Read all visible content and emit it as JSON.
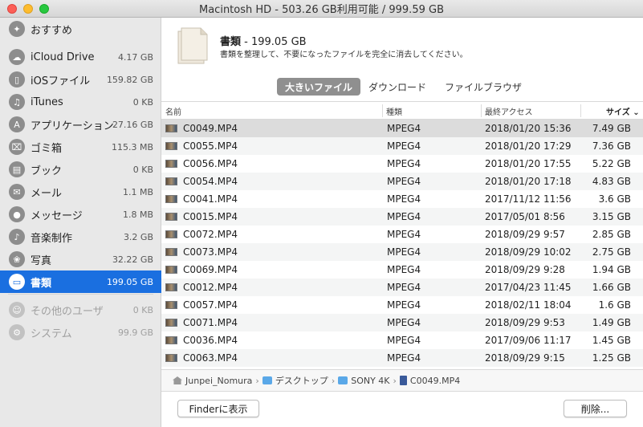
{
  "window": {
    "title": "Macintosh HD - 503.26 GB利用可能 / 999.59 GB"
  },
  "sidebar": {
    "items": [
      {
        "label": "おすすめ",
        "size": "",
        "icon": "bulb-icon",
        "glyph": "✦"
      },
      {
        "label": "iCloud Drive",
        "size": "4.17 GB",
        "icon": "cloud-icon",
        "glyph": "☁"
      },
      {
        "label": "iOSファイル",
        "size": "159.82 GB",
        "icon": "phone-icon",
        "glyph": "▯"
      },
      {
        "label": "iTunes",
        "size": "0 KB",
        "icon": "music-note-icon",
        "glyph": "♫"
      },
      {
        "label": "アプリケーション",
        "size": "27.16 GB",
        "icon": "app-store-icon",
        "glyph": "A"
      },
      {
        "label": "ゴミ箱",
        "size": "115.3 MB",
        "icon": "trash-icon",
        "glyph": "⌧"
      },
      {
        "label": "ブック",
        "size": "0 KB",
        "icon": "book-icon",
        "glyph": "▤"
      },
      {
        "label": "メール",
        "size": "1.1 MB",
        "icon": "mail-icon",
        "glyph": "✉"
      },
      {
        "label": "メッセージ",
        "size": "1.8 MB",
        "icon": "message-bubble-icon",
        "glyph": "●"
      },
      {
        "label": "音楽制作",
        "size": "3.2 GB",
        "icon": "guitar-icon",
        "glyph": "♪"
      },
      {
        "label": "写真",
        "size": "32.22 GB",
        "icon": "photos-icon",
        "glyph": "❀"
      },
      {
        "label": "書類",
        "size": "199.05 GB",
        "icon": "document-icon",
        "glyph": "▭"
      },
      {
        "label": "その他のユーザ",
        "size": "0 KB",
        "icon": "users-icon",
        "glyph": "☺"
      },
      {
        "label": "システム",
        "size": "99.9 GB",
        "icon": "system-gear-icon",
        "glyph": "⚙"
      }
    ],
    "selected_index": 11
  },
  "header": {
    "title": "書類",
    "size": " - 199.05 GB",
    "description": "書類を整理して、不要になったファイルを完全に消去してください。"
  },
  "tabs": [
    {
      "label": "大きいファイル",
      "active": true
    },
    {
      "label": "ダウンロード",
      "active": false
    },
    {
      "label": "ファイルブラウザ",
      "active": false
    }
  ],
  "table": {
    "columns": {
      "name": "名前",
      "kind": "種類",
      "last_access": "最終アクセス",
      "size": "サイズ"
    },
    "rows": [
      {
        "name": "C0049.MP4",
        "kind": "MPEG4",
        "date": "2018/01/20 15:36",
        "size": "7.49 GB"
      },
      {
        "name": "C0055.MP4",
        "kind": "MPEG4",
        "date": "2018/01/20 17:29",
        "size": "7.36 GB"
      },
      {
        "name": "C0056.MP4",
        "kind": "MPEG4",
        "date": "2018/01/20 17:55",
        "size": "5.22 GB"
      },
      {
        "name": "C0054.MP4",
        "kind": "MPEG4",
        "date": "2018/01/20 17:18",
        "size": "4.83 GB"
      },
      {
        "name": "C0041.MP4",
        "kind": "MPEG4",
        "date": "2017/11/12 11:56",
        "size": "3.6 GB"
      },
      {
        "name": "C0015.MP4",
        "kind": "MPEG4",
        "date": "2017/05/01 8:56",
        "size": "3.15 GB"
      },
      {
        "name": "C0072.MP4",
        "kind": "MPEG4",
        "date": "2018/09/29 9:57",
        "size": "2.85 GB"
      },
      {
        "name": "C0073.MP4",
        "kind": "MPEG4",
        "date": "2018/09/29 10:02",
        "size": "2.75 GB"
      },
      {
        "name": "C0069.MP4",
        "kind": "MPEG4",
        "date": "2018/09/29 9:28",
        "size": "1.94 GB"
      },
      {
        "name": "C0012.MP4",
        "kind": "MPEG4",
        "date": "2017/04/23 11:45",
        "size": "1.66 GB"
      },
      {
        "name": "C0057.MP4",
        "kind": "MPEG4",
        "date": "2018/02/11 18:04",
        "size": "1.6 GB"
      },
      {
        "name": "C0071.MP4",
        "kind": "MPEG4",
        "date": "2018/09/29 9:53",
        "size": "1.49 GB"
      },
      {
        "name": "C0036.MP4",
        "kind": "MPEG4",
        "date": "2017/09/06 11:17",
        "size": "1.45 GB"
      },
      {
        "name": "C0063.MP4",
        "kind": "MPEG4",
        "date": "2018/09/29 9:15",
        "size": "1.25 GB"
      }
    ],
    "selected_index": 0
  },
  "path": {
    "crumbs": [
      {
        "label": "Junpei_Nomura",
        "icon": "home-icon"
      },
      {
        "label": "デスクトップ",
        "icon": "folder-icon"
      },
      {
        "label": "SONY 4K",
        "icon": "folder-icon"
      },
      {
        "label": "C0049.MP4",
        "icon": "file-icon"
      }
    ],
    "separator": "›"
  },
  "buttons": {
    "show_in_finder": "Finderに表示",
    "delete": "削除..."
  },
  "colors": {
    "selection_blue": "#1a6fe0",
    "active_tab": "#8f8f8f"
  }
}
